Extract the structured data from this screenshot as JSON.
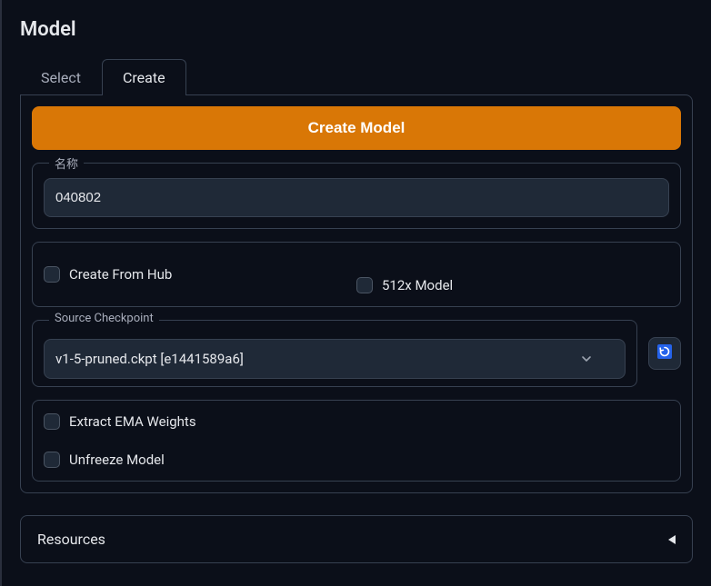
{
  "panel": {
    "title": "Model"
  },
  "tabs": {
    "select": "Select",
    "create": "Create"
  },
  "actions": {
    "create_model": "Create Model"
  },
  "form": {
    "name_label": "名称",
    "name_value": "040802",
    "create_from_hub": "Create From Hub",
    "model_512x": "512x Model",
    "source_checkpoint_label": "Source Checkpoint",
    "source_checkpoint_value": "v1-5-pruned.ckpt [e1441589a6]",
    "extract_ema": "Extract EMA Weights",
    "unfreeze": "Unfreeze Model"
  },
  "resources": {
    "title": "Resources"
  }
}
